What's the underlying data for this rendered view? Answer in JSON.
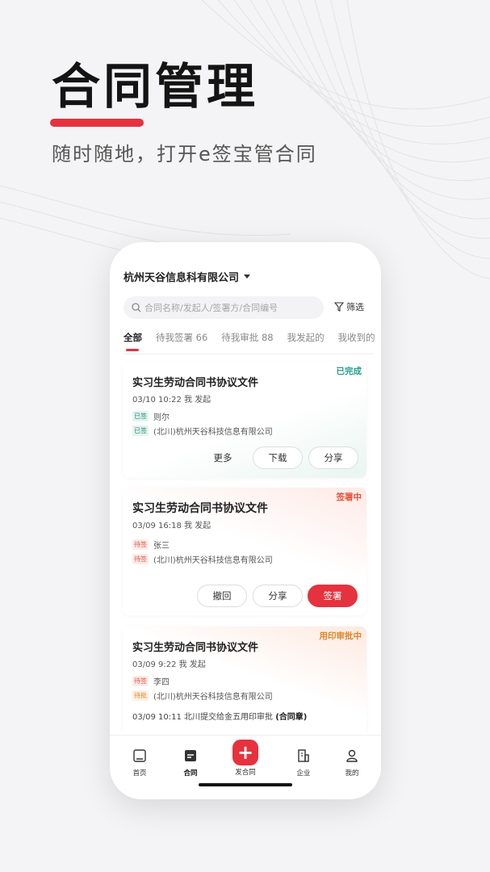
{
  "hero": {
    "title": "合同管理",
    "subtitle": "随时随地，打开e签宝管合同"
  },
  "phone": {
    "company": "杭州天谷信息科有限公司",
    "search_placeholder": "合同名称/发起人/签署方/合同编号",
    "filter_label": "筛选",
    "tabs": [
      "全部",
      "待我签署 66",
      "待我审批 88",
      "我发起的",
      "我收到的"
    ],
    "cards": [
      {
        "status": "已完成",
        "status_color": "#2a9d8f",
        "title": "实习生劳动合同书协议文件",
        "meta": "03/10 10:22  我 发起",
        "signers": [
          {
            "tag": "已签",
            "name": "则尔"
          },
          {
            "tag": "已签",
            "name": "(北川)杭州天谷科技信息有限公司"
          }
        ],
        "buttons": [
          "更多",
          "下载",
          "分享"
        ]
      },
      {
        "status": "签署中",
        "status_color": "#e5533e",
        "title": "实习生劳动合同书协议文件",
        "meta": "03/09 16:18  我 发起",
        "signers": [
          {
            "tag": "待签",
            "name": "张三"
          },
          {
            "tag": "待签",
            "name": "(北川)杭州天谷科技信息有限公司"
          }
        ],
        "buttons": [
          "撤回",
          "分享",
          "签署"
        ]
      },
      {
        "status": "用印审批中",
        "status_color": "#e0862b",
        "title": "实习生劳动合同书协议文件",
        "meta": "03/09 9:22  我 发起",
        "signers": [
          {
            "tag": "待签",
            "name": "李四"
          },
          {
            "tag": "待批",
            "name": "(北川)杭州天谷科技信息有限公司"
          }
        ],
        "log_text": "03/09 10:11 北川提交给金五用印审批",
        "log_bold": "(合同章)"
      }
    ],
    "tabbar": {
      "home": "首页",
      "contract": "合同",
      "add_symbol": "+",
      "add": "发合同",
      "enterprise": "企业",
      "mine": "我的"
    }
  },
  "colors": {
    "brand_red": "#e5323e",
    "done_green": "#2a9d8f",
    "signing_red": "#e5533e",
    "seal_orange": "#e0862b"
  }
}
